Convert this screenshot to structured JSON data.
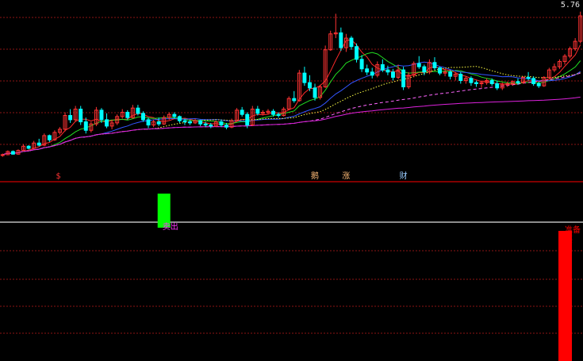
{
  "chart_data": {
    "type": "candlestick",
    "price_axis": {
      "top_value_label": "5.76"
    },
    "candles": [
      [
        3.0,
        3.02,
        2.96,
        3.0
      ],
      [
        3.0,
        3.08,
        2.99,
        3.06
      ],
      [
        3.06,
        3.08,
        3.0,
        3.01
      ],
      [
        3.01,
        3.1,
        3.0,
        3.08
      ],
      [
        3.08,
        3.2,
        3.06,
        3.16
      ],
      [
        3.16,
        3.18,
        3.1,
        3.12
      ],
      [
        3.12,
        3.26,
        3.1,
        3.22
      ],
      [
        3.22,
        3.3,
        3.16,
        3.18
      ],
      [
        3.18,
        3.4,
        3.16,
        3.36
      ],
      [
        3.36,
        3.38,
        3.24,
        3.28
      ],
      [
        3.28,
        3.46,
        3.26,
        3.42
      ],
      [
        3.42,
        3.52,
        3.38,
        3.48
      ],
      [
        3.48,
        3.8,
        3.44,
        3.74
      ],
      [
        3.74,
        3.86,
        3.6,
        3.66
      ],
      [
        3.66,
        3.92,
        3.62,
        3.86
      ],
      [
        3.86,
        3.92,
        3.56,
        3.62
      ],
      [
        3.62,
        3.7,
        3.4,
        3.46
      ],
      [
        3.46,
        3.62,
        3.42,
        3.58
      ],
      [
        3.58,
        3.9,
        3.54,
        3.84
      ],
      [
        3.84,
        3.88,
        3.6,
        3.66
      ],
      [
        3.66,
        3.78,
        3.5,
        3.54
      ],
      [
        3.54,
        3.66,
        3.48,
        3.6
      ],
      [
        3.6,
        3.76,
        3.56,
        3.72
      ],
      [
        3.72,
        3.86,
        3.68,
        3.8
      ],
      [
        3.8,
        3.84,
        3.66,
        3.7
      ],
      [
        3.7,
        3.94,
        3.68,
        3.88
      ],
      [
        3.88,
        3.94,
        3.74,
        3.78
      ],
      [
        3.78,
        3.82,
        3.62,
        3.66
      ],
      [
        3.66,
        3.7,
        3.5,
        3.56
      ],
      [
        3.56,
        3.66,
        3.52,
        3.62
      ],
      [
        3.62,
        3.7,
        3.54,
        3.58
      ],
      [
        3.58,
        3.74,
        3.56,
        3.7
      ],
      [
        3.7,
        3.8,
        3.66,
        3.76
      ],
      [
        3.76,
        3.8,
        3.68,
        3.72
      ],
      [
        3.72,
        3.74,
        3.6,
        3.64
      ],
      [
        3.64,
        3.68,
        3.56,
        3.62
      ],
      [
        3.62,
        3.66,
        3.56,
        3.6
      ],
      [
        3.6,
        3.68,
        3.58,
        3.64
      ],
      [
        3.64,
        3.66,
        3.54,
        3.58
      ],
      [
        3.58,
        3.62,
        3.52,
        3.56
      ],
      [
        3.56,
        3.6,
        3.5,
        3.54
      ],
      [
        3.54,
        3.64,
        3.52,
        3.62
      ],
      [
        3.62,
        3.66,
        3.52,
        3.56
      ],
      [
        3.56,
        3.6,
        3.48,
        3.52
      ],
      [
        3.52,
        3.68,
        3.5,
        3.64
      ],
      [
        3.64,
        3.88,
        3.62,
        3.84
      ],
      [
        3.84,
        3.9,
        3.72,
        3.76
      ],
      [
        3.76,
        3.8,
        3.5,
        3.56
      ],
      [
        3.56,
        3.92,
        3.54,
        3.86
      ],
      [
        3.86,
        3.92,
        3.74,
        3.78
      ],
      [
        3.78,
        3.84,
        3.74,
        3.8
      ],
      [
        3.8,
        3.86,
        3.76,
        3.82
      ],
      [
        3.82,
        3.86,
        3.72,
        3.76
      ],
      [
        3.76,
        3.8,
        3.7,
        3.74
      ],
      [
        3.74,
        3.9,
        3.72,
        3.86
      ],
      [
        3.86,
        4.1,
        3.84,
        4.06
      ],
      [
        4.06,
        4.2,
        3.98,
        4.02
      ],
      [
        4.02,
        4.6,
        4.0,
        4.54
      ],
      [
        4.54,
        4.66,
        4.3,
        4.36
      ],
      [
        4.36,
        4.5,
        4.2,
        4.26
      ],
      [
        4.26,
        4.34,
        4.02,
        4.08
      ],
      [
        4.08,
        4.32,
        4.04,
        4.28
      ],
      [
        4.28,
        5.06,
        4.26,
        4.98
      ],
      [
        4.98,
        5.34,
        4.96,
        5.28
      ],
      [
        5.28,
        5.66,
        5.2,
        5.3
      ],
      [
        5.3,
        5.4,
        4.96,
        5.02
      ],
      [
        5.02,
        5.28,
        4.94,
        5.2
      ],
      [
        5.2,
        5.24,
        4.98,
        5.04
      ],
      [
        5.04,
        5.1,
        4.74,
        4.8
      ],
      [
        4.8,
        4.88,
        4.56,
        4.62
      ],
      [
        4.62,
        4.7,
        4.5,
        4.56
      ],
      [
        4.56,
        4.64,
        4.44,
        4.5
      ],
      [
        4.5,
        4.76,
        4.46,
        4.7
      ],
      [
        4.7,
        4.8,
        4.56,
        4.6
      ],
      [
        4.6,
        4.68,
        4.5,
        4.56
      ],
      [
        4.56,
        4.62,
        4.4,
        4.46
      ],
      [
        4.46,
        4.7,
        4.42,
        4.6
      ],
      [
        4.6,
        4.66,
        4.22,
        4.28
      ],
      [
        4.28,
        4.56,
        4.24,
        4.5
      ],
      [
        4.5,
        4.76,
        4.46,
        4.72
      ],
      [
        4.72,
        4.86,
        4.62,
        4.66
      ],
      [
        4.66,
        4.7,
        4.5,
        4.56
      ],
      [
        4.56,
        4.8,
        4.52,
        4.74
      ],
      [
        4.74,
        4.84,
        4.6,
        4.64
      ],
      [
        4.64,
        4.66,
        4.5,
        4.54
      ],
      [
        4.54,
        4.62,
        4.48,
        4.56
      ],
      [
        4.56,
        4.6,
        4.42,
        4.48
      ],
      [
        4.48,
        4.56,
        4.4,
        4.52
      ],
      [
        4.52,
        4.56,
        4.34,
        4.4
      ],
      [
        4.4,
        4.48,
        4.34,
        4.44
      ],
      [
        4.44,
        4.48,
        4.3,
        4.36
      ],
      [
        4.36,
        4.4,
        4.28,
        4.34
      ],
      [
        4.34,
        4.4,
        4.26,
        4.36
      ],
      [
        4.36,
        4.44,
        4.32,
        4.4
      ],
      [
        4.4,
        4.44,
        4.3,
        4.34
      ],
      [
        4.34,
        4.4,
        4.22,
        4.26
      ],
      [
        4.26,
        4.36,
        4.22,
        4.32
      ],
      [
        4.32,
        4.38,
        4.28,
        4.34
      ],
      [
        4.34,
        4.4,
        4.3,
        4.38
      ],
      [
        4.38,
        4.44,
        4.32,
        4.36
      ],
      [
        4.36,
        4.48,
        4.34,
        4.46
      ],
      [
        4.46,
        4.56,
        4.4,
        4.44
      ],
      [
        4.44,
        4.48,
        4.3,
        4.34
      ],
      [
        4.34,
        4.38,
        4.26,
        4.3
      ],
      [
        4.3,
        4.48,
        4.28,
        4.46
      ],
      [
        4.46,
        4.64,
        4.44,
        4.6
      ],
      [
        4.6,
        4.72,
        4.56,
        4.66
      ],
      [
        4.66,
        4.8,
        4.62,
        4.76
      ],
      [
        4.76,
        4.9,
        4.7,
        4.86
      ],
      [
        4.86,
        5.04,
        4.82,
        5.0
      ],
      [
        5.0,
        5.2,
        4.96,
        5.14
      ],
      [
        5.14,
        5.7,
        5.1,
        5.62
      ]
    ],
    "price_range": [
      2.55,
      5.8
    ],
    "moving_averages": [
      {
        "color": "#ff2a2a",
        "period": 5,
        "style": "solid"
      },
      {
        "color": "#22dd22",
        "period": 10,
        "style": "solid"
      },
      {
        "color": "#3355ff",
        "period": 20,
        "style": "solid"
      },
      {
        "color": "#ffff44",
        "period": 30,
        "style": "dotted"
      },
      {
        "color": "#ff66ff",
        "period": 60,
        "style": "dashed"
      },
      {
        "color": "#dd22dd",
        "period": 120,
        "style": "solid"
      }
    ],
    "colors": {
      "up_candle": "#ff3333",
      "down_candle": "#00ffff",
      "grid_line": "#8b1515",
      "pane_divider": "#ff0000",
      "pane_separator": "#bbbbbb",
      "green_bar": "#00ff00",
      "red_bar": "#ff0000",
      "marker_red": "#ff3333",
      "marker_orange": "#ffbb77",
      "marker_blue": "#99ccff",
      "label_magenta": "#ff33ff"
    },
    "markers": [
      {
        "index": 11,
        "text": "$",
        "color": "#ff3333"
      },
      {
        "index": 60,
        "text": "鹅",
        "color": "#ffbb77"
      },
      {
        "index": 66,
        "text": "涨",
        "color": "#ffbb77"
      },
      {
        "index": 77,
        "text": "财",
        "color": "#99ccff"
      }
    ],
    "signals": [
      {
        "index": 31,
        "kind": "green",
        "label": "卖出",
        "height_fraction": 0.72
      },
      {
        "index": 108,
        "kind": "red",
        "label": "准备买",
        "height_fraction": 1.0
      }
    ]
  }
}
